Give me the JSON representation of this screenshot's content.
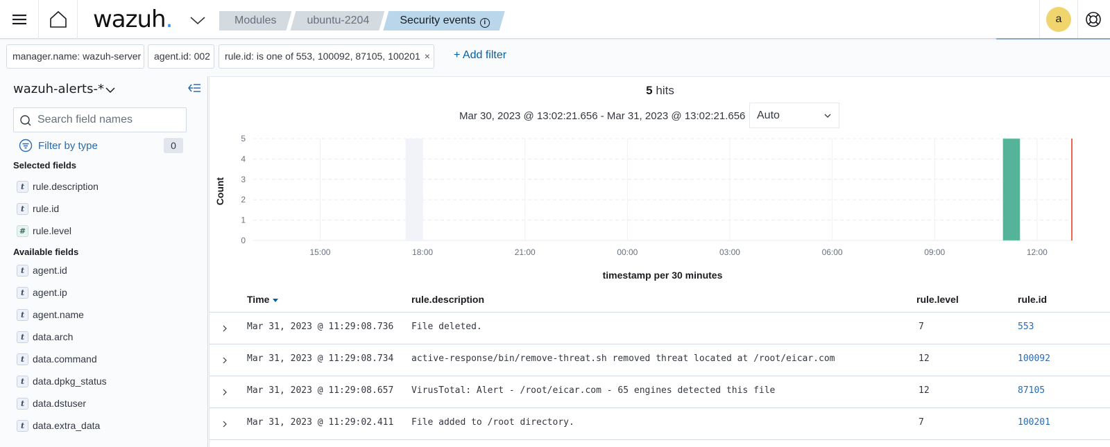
{
  "header": {
    "logo_text": "wazuh",
    "logo_dot": ".",
    "breadcrumbs": [
      {
        "label": "Modules"
      },
      {
        "label": "ubuntu-2204"
      },
      {
        "label": "Security events",
        "info_icon": "i"
      }
    ],
    "avatar_letter": "a",
    "icons": {
      "menu": "hamburger-icon",
      "home": "home-icon",
      "help": "lifebuoy-icon"
    }
  },
  "filters": {
    "pills": [
      {
        "label": "manager.name: wazuh-server"
      },
      {
        "label": "agent.id: 002"
      },
      {
        "label": "rule.id: is one of 553, 100092, 87105, 100201",
        "remove": "×"
      }
    ],
    "add_filter_label": "+ Add filter"
  },
  "sidebar": {
    "index_pattern": "wazuh-alerts-*",
    "search_placeholder": "Search field names",
    "search_value": "",
    "filter_by_type_label": "Filter by type",
    "filter_by_type_count": "0",
    "selected_title": "Selected fields",
    "selected_fields": [
      {
        "type": "t",
        "name": "rule.description"
      },
      {
        "type": "t",
        "name": "rule.id"
      },
      {
        "type": "#",
        "name": "rule.level"
      }
    ],
    "available_title": "Available fields",
    "available_fields": [
      {
        "type": "t",
        "name": "agent.id"
      },
      {
        "type": "t",
        "name": "agent.ip"
      },
      {
        "type": "t",
        "name": "agent.name"
      },
      {
        "type": "t",
        "name": "data.arch"
      },
      {
        "type": "t",
        "name": "data.command"
      },
      {
        "type": "t",
        "name": "data.dpkg_status"
      },
      {
        "type": "t",
        "name": "data.dstuser"
      },
      {
        "type": "t",
        "name": "data.extra_data"
      }
    ]
  },
  "main": {
    "hits_count": "5",
    "hits_label": " hits",
    "time_range": "Mar 30, 2023 @ 13:02:21.656 - Mar 31, 2023 @ 13:02:21.656",
    "interval_value": "Auto"
  },
  "chart_data": {
    "type": "bar",
    "title": "",
    "xlabel": "timestamp per 30 minutes",
    "ylabel": "Count",
    "x_start_hours": 13.0393,
    "x_end_hours": 37.0393,
    "x_ticks": [
      {
        "label": "15:00",
        "hour": 15
      },
      {
        "label": "18:00",
        "hour": 18
      },
      {
        "label": "21:00",
        "hour": 21
      },
      {
        "label": "00:00",
        "hour": 24
      },
      {
        "label": "03:00",
        "hour": 27
      },
      {
        "label": "06:00",
        "hour": 30
      },
      {
        "label": "09:00",
        "hour": 33
      },
      {
        "label": "12:00",
        "hour": 36
      }
    ],
    "y_ticks": [
      0,
      1,
      2,
      3,
      4,
      5
    ],
    "ylim": [
      0,
      5
    ],
    "bin_hours": 0.5,
    "bars": [
      {
        "label": "Mar 31, 2023 11:00",
        "start_hour": 35.0,
        "value": 5
      }
    ],
    "hover_band": {
      "start_hour": 17.5
    },
    "now_marker_hour": 37.0393,
    "grid": true,
    "colors": {
      "bar": "#54b399",
      "now_marker": "#e7664c",
      "hover_band": "#f1f3f8"
    }
  },
  "table": {
    "columns": [
      {
        "label": "Time",
        "sorted": "desc"
      },
      {
        "label": "rule.description"
      },
      {
        "label": "rule.level"
      },
      {
        "label": "rule.id"
      }
    ],
    "rows": [
      {
        "time": "Mar 31, 2023 @ 11:29:08.736",
        "description": "File deleted.",
        "level": "7",
        "id": "553"
      },
      {
        "time": "Mar 31, 2023 @ 11:29:08.734",
        "description": "active-response/bin/remove-threat.sh removed threat located at /root/eicar.com",
        "level": "12",
        "id": "100092"
      },
      {
        "time": "Mar 31, 2023 @ 11:29:08.657",
        "description": "VirusTotal: Alert - /root/eicar.com - 65 engines detected this file",
        "level": "12",
        "id": "87105"
      },
      {
        "time": "Mar 31, 2023 @ 11:29:02.411",
        "description": "File added to /root directory.",
        "level": "7",
        "id": "100201"
      }
    ]
  }
}
